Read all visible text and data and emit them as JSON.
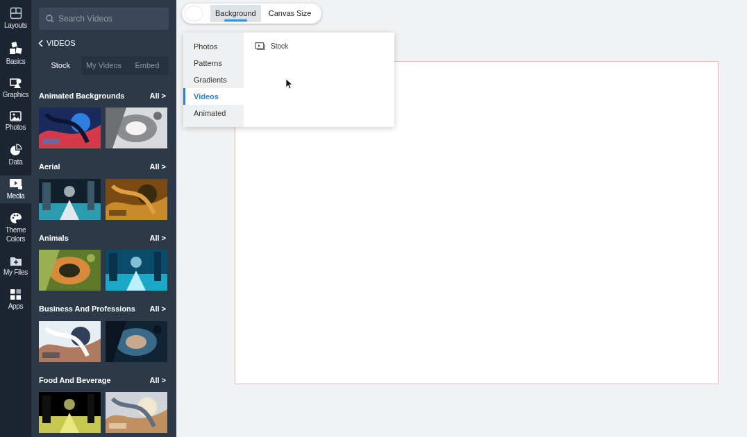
{
  "rail": [
    {
      "label": "Layouts",
      "selected": false
    },
    {
      "label": "Basics",
      "selected": false
    },
    {
      "label": "Graphics",
      "selected": false
    },
    {
      "label": "Photos",
      "selected": false
    },
    {
      "label": "Data",
      "selected": false
    },
    {
      "label": "Media",
      "selected": true
    },
    {
      "label": "Theme Colors",
      "selected": false
    },
    {
      "label": "My Files",
      "selected": false
    },
    {
      "label": "Apps",
      "selected": false
    }
  ],
  "search": {
    "placeholder": "Search Videos"
  },
  "back": {
    "label": "VIDEOS"
  },
  "source_tabs": [
    {
      "label": "Stock",
      "selected": true
    },
    {
      "label": "My Videos",
      "selected": false
    },
    {
      "label": "Embed",
      "selected": false
    }
  ],
  "sections": [
    {
      "title": "Animated Backgrounds",
      "link": "All >"
    },
    {
      "title": "Aerial",
      "link": "All >"
    },
    {
      "title": "Animals",
      "link": "All >"
    },
    {
      "title": "Business And Professions",
      "link": "All >"
    },
    {
      "title": "Food And Beverage",
      "link": "All >"
    }
  ],
  "toolbar": {
    "tabs": [
      {
        "label": "Background",
        "selected": true
      },
      {
        "label": "Canvas Size",
        "selected": false
      }
    ]
  },
  "background_menu": {
    "categories": [
      {
        "label": "Photos",
        "selected": false
      },
      {
        "label": "Patterns",
        "selected": false
      },
      {
        "label": "Gradients",
        "selected": false
      },
      {
        "label": "Videos",
        "selected": true
      },
      {
        "label": "Animated",
        "selected": false
      }
    ],
    "options": [
      {
        "label": "Stock"
      }
    ]
  }
}
